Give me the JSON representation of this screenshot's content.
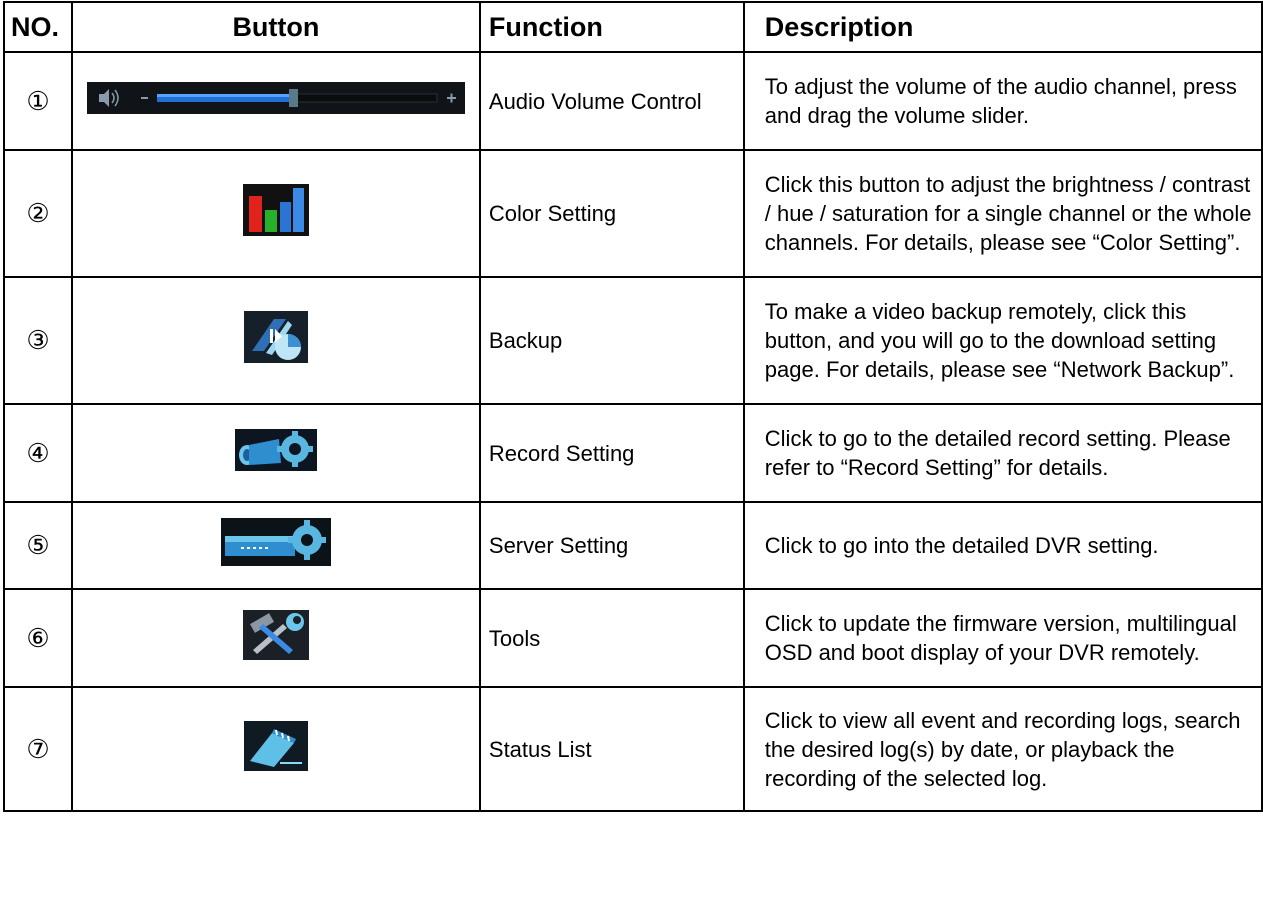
{
  "headers": {
    "no": "NO.",
    "button": "Button",
    "function": "Function",
    "description": "Description"
  },
  "rows": [
    {
      "no": "①",
      "icon": "volume-slider-icon",
      "function": "Audio Volume Control",
      "description": "To adjust the volume of the audio channel, press and drag the volume slider."
    },
    {
      "no": "②",
      "icon": "color-bars-icon",
      "function": "Color Setting",
      "description": "Click this button to adjust the brightness / contrast / hue / saturation for a single channel or the whole channels. For details, please see “Color Setting”."
    },
    {
      "no": "③",
      "icon": "backup-icon",
      "function": "Backup",
      "description": "To make a video backup remotely, click this button, and you will go to the download setting page. For details, please see “Network Backup”."
    },
    {
      "no": "④",
      "icon": "camera-gear-icon",
      "function": "Record Setting",
      "description": "Click to go to the detailed record setting. Please refer to “Record Setting” for details."
    },
    {
      "no": "⑤",
      "icon": "server-gear-icon",
      "function": "Server Setting",
      "description": "Click to go into the detailed DVR setting."
    },
    {
      "no": "⑥",
      "icon": "tools-icon",
      "function": "Tools",
      "description": "Click to update the firmware version, multilingual OSD and boot display of your DVR remotely."
    },
    {
      "no": "⑦",
      "icon": "status-list-icon",
      "function": "Status List",
      "description": "Click to view all event and recording logs, search the desired log(s) by date, or playback the recording of the selected log."
    }
  ]
}
